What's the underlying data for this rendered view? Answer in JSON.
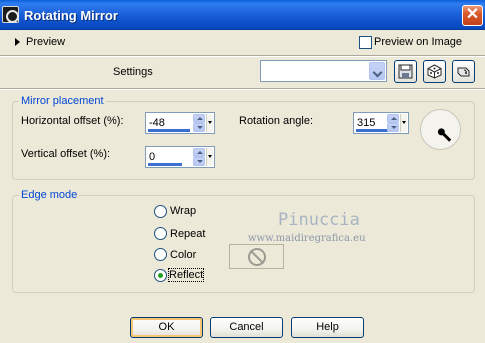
{
  "window": {
    "title": "Rotating Mirror",
    "close_glyph": "✕"
  },
  "preview": {
    "toggle_label": "Preview",
    "preview_on_image_label": "Preview on Image",
    "preview_on_image_checked": false
  },
  "settings": {
    "label": "Settings",
    "value": "",
    "icons": [
      "save-preset-icon",
      "randomize-dice-icon",
      "reset-icon"
    ]
  },
  "mirror_placement": {
    "title": "Mirror placement",
    "horizontal_offset_label": "Horizontal offset (%):",
    "horizontal_offset_value": "-48",
    "vertical_offset_label": "Vertical offset (%):",
    "vertical_offset_value": "0",
    "rotation_angle_label": "Rotation angle:",
    "rotation_angle_value": "315"
  },
  "edge_mode": {
    "title": "Edge mode",
    "options": [
      {
        "label": "Wrap",
        "selected": false
      },
      {
        "label": "Repeat",
        "selected": false
      },
      {
        "label": "Color",
        "selected": false
      },
      {
        "label": "Reflect",
        "selected": true
      }
    ],
    "color_icon": "no-color-icon"
  },
  "watermark": {
    "name": "Pinuccia",
    "url": "www.maidiregrafica.eu"
  },
  "buttons": {
    "ok": "OK",
    "cancel": "Cancel",
    "help": "Help"
  },
  "colors": {
    "title_bar": "#1d63dd",
    "group_title": "#0046d5",
    "dialog_bg": "#ece9d8",
    "selected_radio": "#21a121"
  }
}
